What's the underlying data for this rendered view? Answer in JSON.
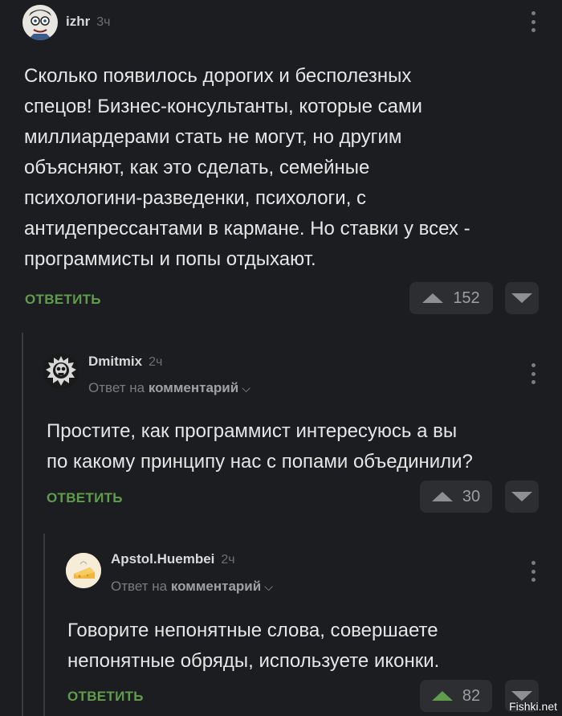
{
  "comments": [
    {
      "username": "izhr",
      "time": "3ч",
      "text": "Сколько появилось дорогих и бесполезных\nспецов! Бизнес-консультанты, которые сами\nмиллиардерами стать не могут, но другим\nобъясняют, как это сделать, семейные\nпсихологини-разведенки, психологи, с\nантидепрессантами в кармане. Но ставки у всех -\nпрограммисты и попы отдыхают.",
      "reply_label": "ОТВЕТИТЬ",
      "rating": "152",
      "avatar_icon": "cartoon-face-avatar"
    },
    {
      "username": "Dmitmix",
      "time": "2ч",
      "reply_prefix": "Ответ на",
      "reply_target": "комментарий",
      "text": "Простите, как программист интересуюсь а вы\nпо какому принципу нас с попами объединили?",
      "reply_label": "ОТВЕТИТЬ",
      "rating": "30",
      "avatar_icon": "skull-gear-avatar"
    },
    {
      "username": "Apstol.Huembei",
      "time": "2ч",
      "reply_prefix": "Ответ на",
      "reply_target": "комментарий",
      "text": "Говорите непонятные слова, совершаете\nнепонятные обряды, используете иконки.",
      "reply_label": "ОТВЕТИТЬ",
      "rating": "82",
      "avatar_icon": "cheese-avatar"
    }
  ],
  "watermark": "Fishki.net",
  "colors": {
    "background": "#1c1d20",
    "accent_green": "#5f9c4b",
    "button_bg": "#2d2e32"
  }
}
